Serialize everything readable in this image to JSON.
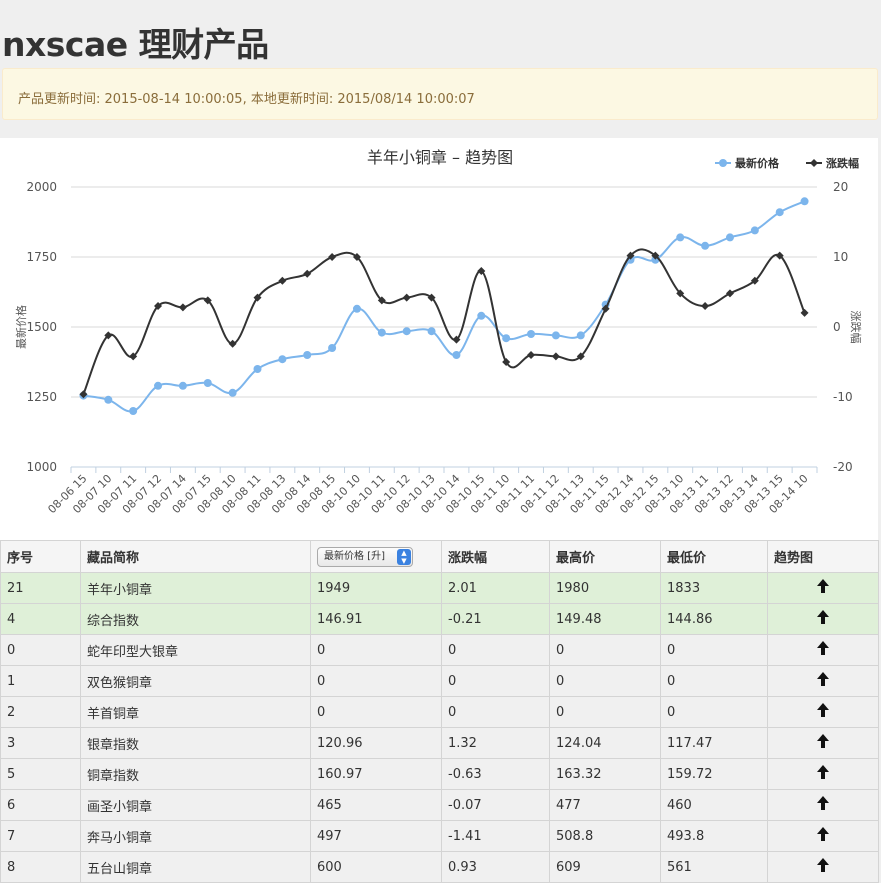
{
  "page": {
    "title": "nxscae 理财产品",
    "notice": "产品更新时间: 2015-08-14 10:00:05, 本地更新时间: 2015/08/14 10:00:07"
  },
  "chart_data": {
    "type": "line",
    "title": "羊年小铜章 – 趋势图",
    "ylabel": "最新价格",
    "y2label": "涨跌幅",
    "ylim": [
      1000,
      2000
    ],
    "y2lim": [
      -20,
      20
    ],
    "yticks": [
      "2000",
      "1750",
      "1500",
      "1250",
      "1000"
    ],
    "y2ticks": [
      "20",
      "10",
      "0",
      "-10",
      "-20"
    ],
    "legend_position": "top-right",
    "categories": [
      "08-06 15",
      "08-07 10",
      "08-07 11",
      "08-07 12",
      "08-07 14",
      "08-07 15",
      "08-08 10",
      "08-08 11",
      "08-08 13",
      "08-08 14",
      "08-08 15",
      "08-10 10",
      "08-10 11",
      "08-10 12",
      "08-10 13",
      "08-10 14",
      "08-10 15",
      "08-11 10",
      "08-11 11",
      "08-11 12",
      "08-11 13",
      "08-11 15",
      "08-12 14",
      "08-12 15",
      "08-13 10",
      "08-13 11",
      "08-13 12",
      "08-13 14",
      "08-13 15",
      "08-14 10"
    ],
    "series": [
      {
        "name": "最新价格",
        "axis": "left",
        "color": "#7cb5ec",
        "values": [
          1255,
          1240,
          1200,
          1290,
          1290,
          1300,
          1265,
          1350,
          1385,
          1400,
          1425,
          1565,
          1480,
          1485,
          1485,
          1400,
          1540,
          1460,
          1475,
          1470,
          1470,
          1580,
          1740,
          1740,
          1820,
          1790,
          1820,
          1845,
          1910,
          1949
        ]
      },
      {
        "name": "涨跌幅",
        "axis": "right",
        "color": "#333333",
        "values": [
          -9.6,
          -1.2,
          -4.2,
          3.0,
          2.8,
          3.8,
          -2.4,
          4.2,
          6.6,
          7.6,
          10.0,
          10.0,
          3.8,
          4.2,
          4.2,
          -1.8,
          8.0,
          -5.0,
          -4.0,
          -4.2,
          -4.2,
          2.6,
          10.2,
          10.2,
          4.8,
          3.0,
          4.8,
          6.6,
          10.2,
          2.01
        ]
      }
    ]
  },
  "table": {
    "headers": {
      "index": "序号",
      "name": "藏品简称",
      "sort_select": "最新价格 [升]",
      "change": "涨跌幅",
      "high": "最高价",
      "low": "最低价",
      "trend": "趋势图"
    },
    "rows": [
      {
        "index": "21",
        "name": "羊年小铜章",
        "price": "1949",
        "change": "2.01",
        "high": "1980",
        "low": "1833",
        "highlight": true
      },
      {
        "index": "4",
        "name": "综合指数",
        "price": "146.91",
        "change": "-0.21",
        "high": "149.48",
        "low": "144.86",
        "highlight": true
      },
      {
        "index": "0",
        "name": "蛇年印型大银章",
        "price": "0",
        "change": "0",
        "high": "0",
        "low": "0",
        "highlight": false
      },
      {
        "index": "1",
        "name": "双色猴铜章",
        "price": "0",
        "change": "0",
        "high": "0",
        "low": "0",
        "highlight": false
      },
      {
        "index": "2",
        "name": "羊首铜章",
        "price": "0",
        "change": "0",
        "high": "0",
        "low": "0",
        "highlight": false
      },
      {
        "index": "3",
        "name": "银章指数",
        "price": "120.96",
        "change": "1.32",
        "high": "124.04",
        "low": "117.47",
        "highlight": false
      },
      {
        "index": "5",
        "name": "铜章指数",
        "price": "160.97",
        "change": "-0.63",
        "high": "163.32",
        "low": "159.72",
        "highlight": false
      },
      {
        "index": "6",
        "name": "画圣小铜章",
        "price": "465",
        "change": "-0.07",
        "high": "477",
        "low": "460",
        "highlight": false
      },
      {
        "index": "7",
        "name": "奔马小铜章",
        "price": "497",
        "change": "-1.41",
        "high": "508.8",
        "low": "493.8",
        "highlight": false
      },
      {
        "index": "8",
        "name": "五台山铜章",
        "price": "600",
        "change": "0.93",
        "high": "609",
        "low": "561",
        "highlight": false
      }
    ],
    "trend_icon": "arrow-up-icon"
  }
}
